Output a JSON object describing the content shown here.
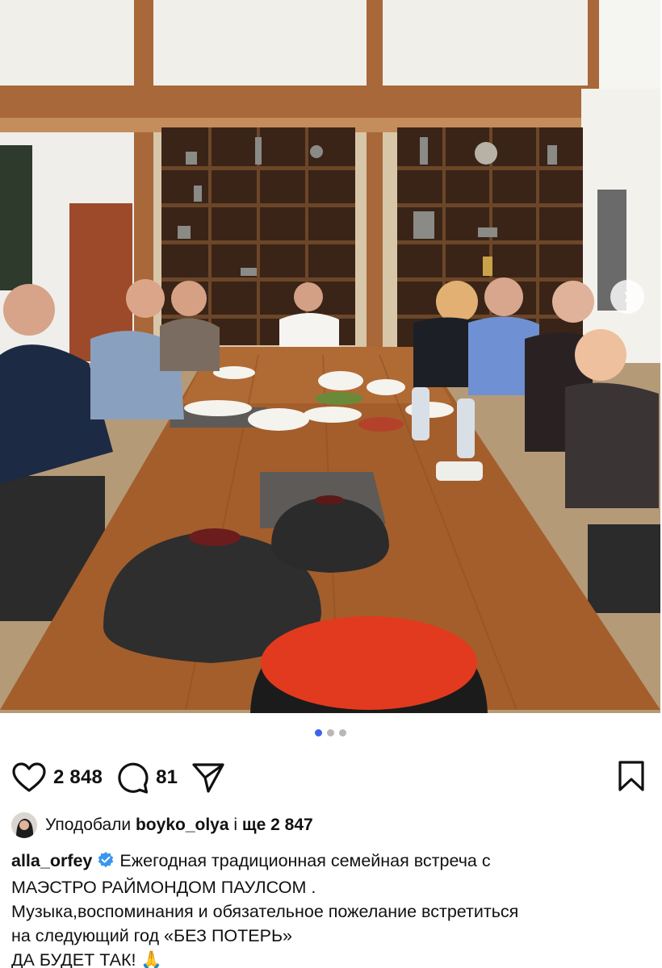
{
  "post": {
    "carousel": {
      "slide_count": 3,
      "active_index": 0
    },
    "actions": {
      "like_count": "2 848",
      "comment_count": "81"
    },
    "likes": {
      "prefix": "Уподобали",
      "liked_by": "boyko_olya",
      "connector": "і",
      "others": "ще 2 847"
    },
    "caption": {
      "username": "alla_orfey",
      "verified": true,
      "lines": [
        "Ежегодная традиционная семейная встреча с",
        "МАЭСТРО РАЙМОНДОМ ПАУЛСОМ .",
        "Музыка,воспоминания и обязательное пожелание встретиться",
        "на следующий год «БЕЗ ПОТЕРЬ»",
        "ДА БУДЕТ ТАК! 🙏"
      ]
    }
  },
  "colors": {
    "carousel_active": "#3d63e8",
    "carousel_inactive": "#b8b8b8",
    "verified_badge": "#3897f0"
  },
  "icons": [
    "heart-icon",
    "comment-icon",
    "share-icon",
    "bookmark-icon",
    "verified-badge-icon",
    "chevron-right-icon"
  ]
}
